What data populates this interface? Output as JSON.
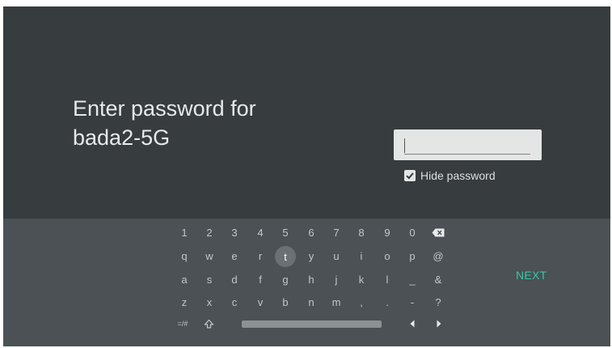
{
  "prompt": {
    "line1": "Enter password for",
    "line2": "bada2-5G"
  },
  "password_field": {
    "value": ""
  },
  "hide_password": {
    "label": "Hide password",
    "checked": true
  },
  "keyboard": {
    "rows": [
      [
        "1",
        "2",
        "3",
        "4",
        "5",
        "6",
        "7",
        "8",
        "9",
        "0"
      ],
      [
        "q",
        "w",
        "e",
        "r",
        "t",
        "y",
        "u",
        "i",
        "o",
        "p",
        "@"
      ],
      [
        "a",
        "s",
        "d",
        "f",
        "g",
        "h",
        "j",
        "k",
        "l",
        "_",
        "&"
      ],
      [
        "z",
        "x",
        "c",
        "v",
        "b",
        "n",
        "m",
        ",",
        ".",
        "-",
        "?"
      ]
    ],
    "symbols_key": "=/#",
    "focused_key": "t",
    "next_label": "NEXT"
  },
  "icons": {
    "backspace": "backspace-icon",
    "shift": "shift-icon",
    "left": "arrow-left-icon",
    "right": "arrow-right-icon",
    "check": "check-icon"
  },
  "colors": {
    "background": "#373c3e",
    "keyboard": "#4b5154",
    "accent": "#36c8a7"
  }
}
